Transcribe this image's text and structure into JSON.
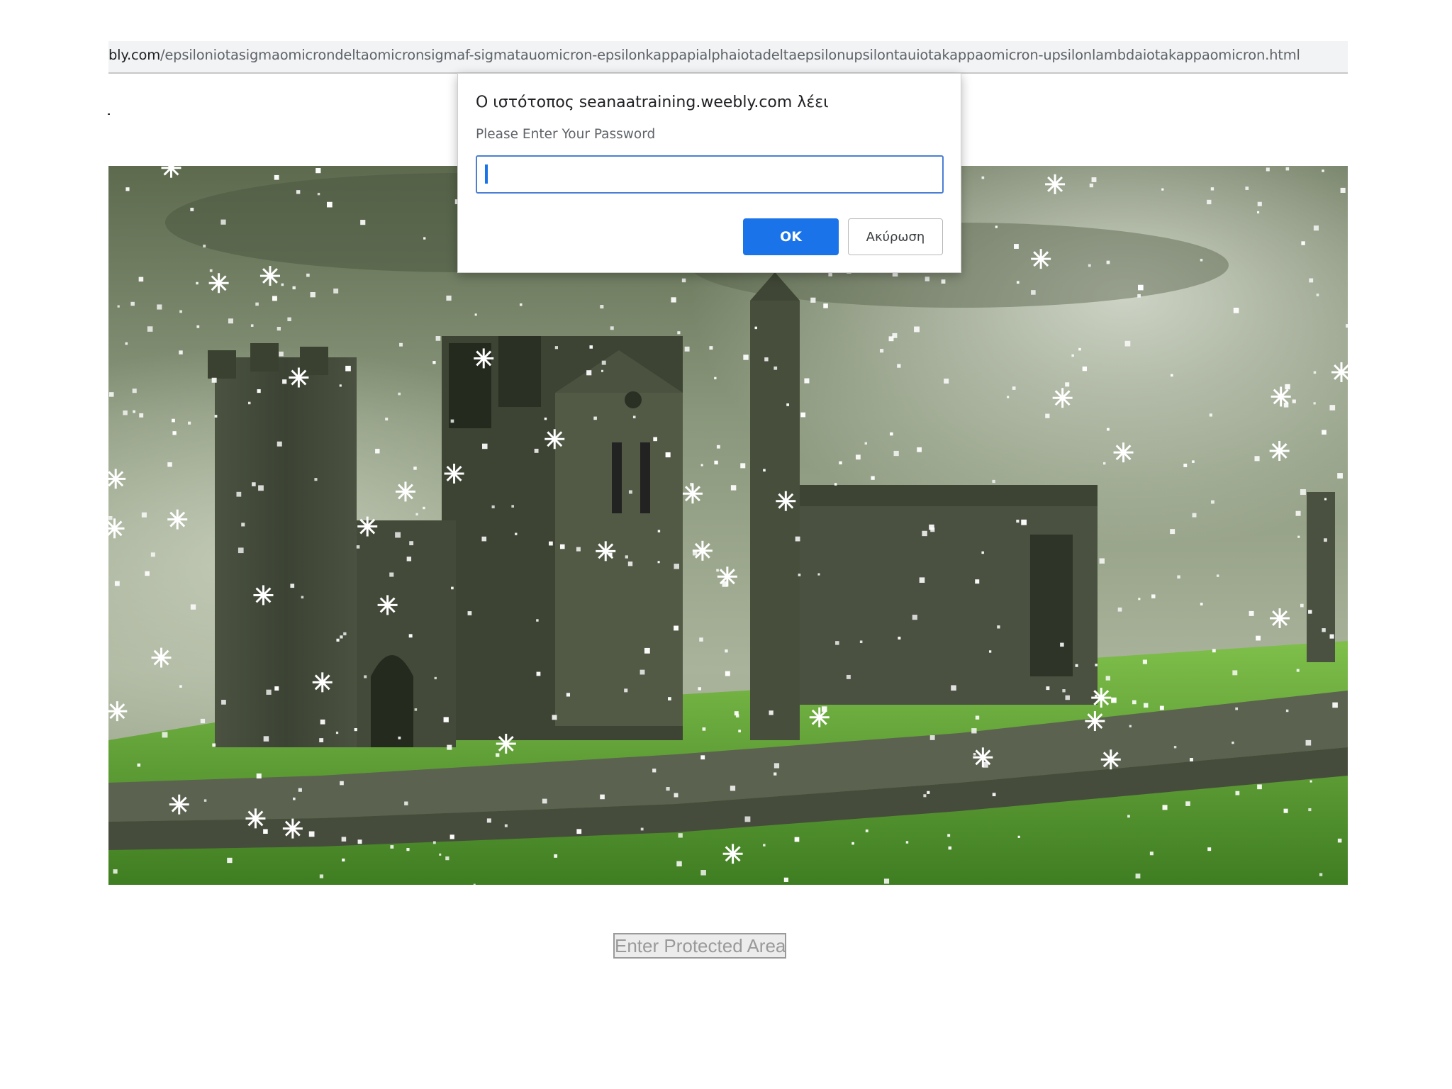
{
  "browser": {
    "url_host": "bly.com",
    "url_path": "/epsiloniotasigmaomicrondeltaomicronsigmaf-sigmatauomicron-epsilonkappapialphaiotadeltaepsilonupsilontauiotakappaomicron-upsilonlambdaiotakappaomicron.html"
  },
  "dialog": {
    "title": "Ο ιστότοπος seanaatraining.weebly.com λέει",
    "message": "Please Enter Your Password",
    "input_value": "",
    "ok_label": "OK",
    "cancel_label": "Ακύρωση"
  },
  "page": {
    "scene_image": "snowy-castle-ruins-on-green-hill",
    "protected_button_label": "Enter Protected Area"
  },
  "colors": {
    "accent": "#1a73e8",
    "input_border": "#4a7fd4",
    "grass": "#6aa83a",
    "sky": "#7c8a6e"
  }
}
